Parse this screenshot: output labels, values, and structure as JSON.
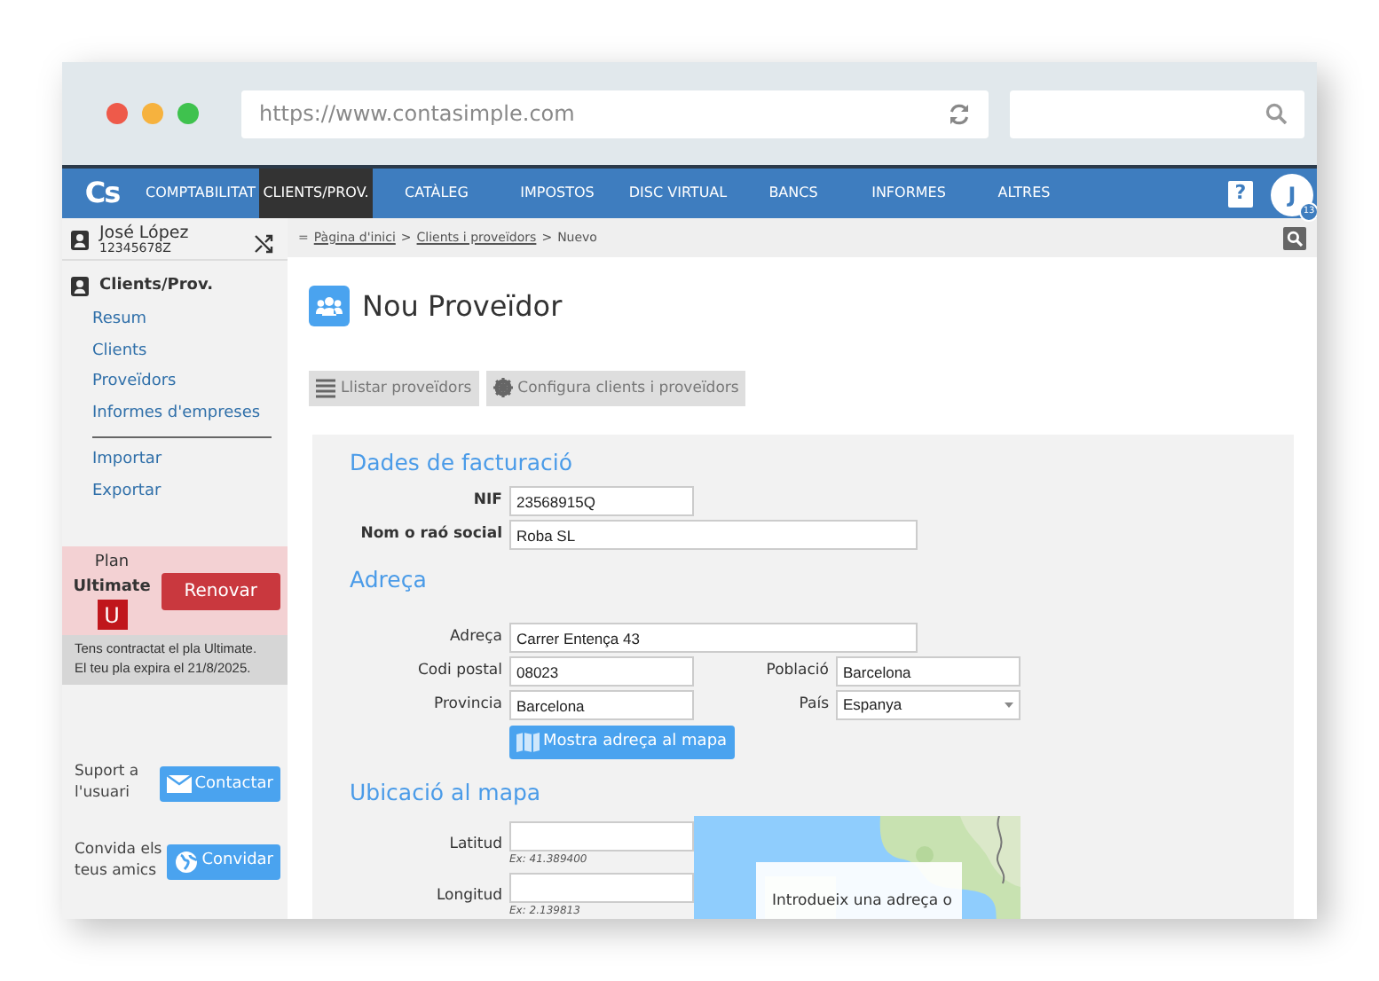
{
  "browser": {
    "url": "https://www.contasimple.com"
  },
  "nav": {
    "logo": "Cs",
    "items": [
      {
        "label": "COMPTABILITAT",
        "selected": false
      },
      {
        "label": "CLIENTS/PROV.",
        "selected": true
      },
      {
        "label": "CATÀLEG",
        "selected": false
      },
      {
        "label": "IMPOSTOS",
        "selected": false
      },
      {
        "label": "DISC VIRTUAL",
        "selected": false
      },
      {
        "label": "BANCS",
        "selected": false
      },
      {
        "label": "INFORMES",
        "selected": false
      },
      {
        "label": "ALTRES",
        "selected": false
      }
    ],
    "help": "?",
    "avatar": "J",
    "badge": "13"
  },
  "sidebar": {
    "user": {
      "name": "José López",
      "id": "12345678Z"
    },
    "section": "Clients/Prov.",
    "groups": [
      [
        "Resum",
        "Clients",
        "Proveïdors",
        "Informes d'empreses"
      ],
      [
        "Importar",
        "Exportar"
      ]
    ],
    "plan": {
      "label": "Plan",
      "name": "Ultimate",
      "letter": "U",
      "button": "Renovar",
      "note": [
        "Tens contractat el pla Ultimate.",
        "El teu pla expira el 21/8/2025."
      ]
    },
    "actions": [
      {
        "text": "Suport a l'usuari",
        "button": "Contactar",
        "kind": "mail"
      },
      {
        "text": "Convida els teus amics",
        "button": "Convidar",
        "kind": "globe"
      }
    ]
  },
  "breadcrumb": {
    "marker": "=",
    "sep": ">",
    "items": [
      {
        "label": "Pàgina d'inici",
        "link": true
      },
      {
        "label": "Clients i proveïdors",
        "link": true
      },
      {
        "label": "Nuevo",
        "link": false
      }
    ]
  },
  "title": "Nou Proveïdor",
  "toolbar": [
    {
      "label": "Llistar proveïdors",
      "kind": "list"
    },
    {
      "label": "Configura clients i proveïdors",
      "kind": "gear"
    }
  ],
  "billing": {
    "title": "Dades de facturació",
    "fields": [
      {
        "label": "NIF",
        "value": "23568915Q"
      },
      {
        "label": "Nom o raó social",
        "value": "Roba SL"
      }
    ]
  },
  "address": {
    "title": "Adreça",
    "street": {
      "label": "Adreça",
      "value": "Carrer Entença 43"
    },
    "postal": {
      "label": "Codi postal",
      "value": "08023"
    },
    "city": {
      "label": "Població",
      "value": "Barcelona"
    },
    "province": {
      "label": "Provincia",
      "value": "Barcelona"
    },
    "country": {
      "label": "País",
      "value": "Espanya"
    },
    "map_button": "Mostra adreça al mapa"
  },
  "location": {
    "title": "Ubicació al mapa",
    "fields": [
      {
        "label": "Latitud",
        "hint": "Ex: 41.389400"
      },
      {
        "label": "Longitud",
        "hint": "Ex: 2.139813"
      }
    ],
    "map": {
      "kind": "picture",
      "overlay": "Introdueix una adreça o"
    }
  }
}
